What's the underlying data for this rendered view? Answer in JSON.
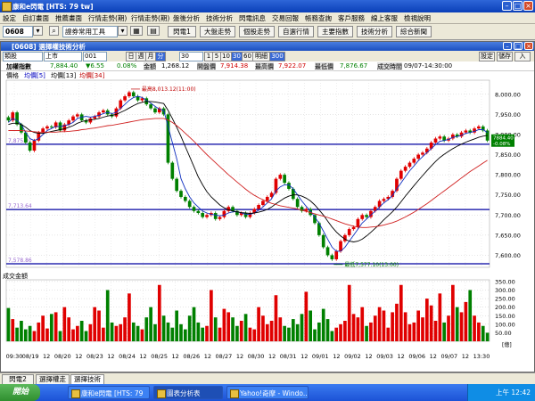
{
  "window": {
    "title": "康和e閃電 [HTS: 79 tw]"
  },
  "menu": [
    "設定",
    "自訂畫面",
    "推薦畫面",
    "行情走勢(期)",
    "行情走勢(期)",
    "盤後分析",
    "技術分析",
    "閃電訊息",
    "交易回報",
    "帳務查詢",
    "客戶服務",
    "線上客服",
    "檢視說明"
  ],
  "toolbar": {
    "code": "0608",
    "tool_select": "證券常用工具",
    "buttons": [
      "閃電1",
      "大盤走勢",
      "個股走勢",
      "自選行情",
      "主要指數",
      "技術分析",
      "綜合新聞"
    ]
  },
  "inner": {
    "title": "[0608] 選擇權技術分析",
    "controls": {
      "kind": "類股",
      "market": "上市",
      "code": "001",
      "periods": [
        "日",
        "週",
        "月",
        "分"
      ],
      "active_period": "分",
      "minute_value": "30",
      "minutes": [
        "1",
        "5",
        "10",
        "30",
        "60"
      ],
      "active_minute": "30",
      "tick": "明細",
      "count": "300",
      "right_buttons": [
        "設定",
        "儲存",
        "入"
      ]
    },
    "info": {
      "name": "加權指數",
      "price": "7,884.40",
      "change": "▼6.55",
      "pct": "0.08%",
      "amt_label": "金額",
      "amt": "1,268.12",
      "open_label": "開盤價",
      "open": "7,914.38",
      "high_label": "最高價",
      "high": "7,922.07",
      "low_label": "最低價",
      "low": "7,876.67",
      "time_label": "成交時間",
      "time": "09/07-14:30:00"
    },
    "legend": {
      "price": "價格",
      "ma5": "均價[5]",
      "ma13": "均價[13]",
      "ma34": "均價[34]"
    },
    "volume_label": "成交金額"
  },
  "chart_data": [
    {
      "type": "candlestick",
      "title": "加權指數",
      "x_labels": [
        "09:30",
        "08/19",
        "12",
        "08/20",
        "12",
        "08/23",
        "12",
        "08/24",
        "12",
        "08/25",
        "12",
        "08/26",
        "12",
        "08/27",
        "12",
        "08/30",
        "12",
        "08/31",
        "12",
        "09/01",
        "12",
        "09/02",
        "12",
        "09/03",
        "12",
        "09/06",
        "12",
        "09/07",
        "12",
        "13:30"
      ],
      "y_ticks": [
        8000,
        7950,
        7900,
        7850,
        7800,
        7750,
        7700,
        7650,
        7600
      ],
      "ylim": [
        7570,
        8035
      ],
      "hlines": [
        {
          "value": 7875.91,
          "label": "7,875.91"
        },
        {
          "value": 7713.64,
          "label": "7,713.64"
        },
        {
          "value": 7578.86,
          "label": "7,578.86"
        }
      ],
      "annotations": [
        {
          "text": "最高8,013.12(11:00)"
        },
        {
          "text": "最低7,577.10(13:00)"
        }
      ],
      "last_price_tag": "7884.40",
      "last_change_tag": "-0.08%",
      "closes": [
        7935,
        7955,
        7925,
        7905,
        7880,
        7860,
        7885,
        7905,
        7915,
        7920,
        7918,
        7930,
        7910,
        7925,
        7935,
        7945,
        7950,
        7935,
        7930,
        7940,
        7945,
        7955,
        7960,
        7950,
        7945,
        7965,
        7985,
        7995,
        8005,
        7995,
        7985,
        7990,
        7975,
        7965,
        7955,
        7965,
        7950,
        7830,
        7790,
        7760,
        7745,
        7735,
        7720,
        7710,
        7705,
        7695,
        7700,
        7705,
        7690,
        7695,
        7710,
        7720,
        7710,
        7700,
        7705,
        7695,
        7705,
        7715,
        7725,
        7735,
        7745,
        7755,
        7790,
        7800,
        7780,
        7765,
        7740,
        7720,
        7710,
        7715,
        7700,
        7680,
        7650,
        7620,
        7600,
        7590,
        7610,
        7635,
        7650,
        7665,
        7670,
        7690,
        7700,
        7695,
        7710,
        7720,
        7735,
        7740,
        7745,
        7760,
        7790,
        7810,
        7820,
        7830,
        7840,
        7850,
        7855,
        7865,
        7880,
        7890,
        7895,
        7885,
        7890,
        7900,
        7895,
        7905,
        7910,
        7905,
        7915,
        7920,
        7910,
        7885
      ],
      "ma5": [
        7930,
        7940,
        7935,
        7925,
        7905,
        7890,
        7885,
        7890,
        7900,
        7910,
        7915,
        7920,
        7920,
        7922,
        7925,
        7930,
        7940,
        7943,
        7945,
        7943,
        7945,
        7948,
        7952,
        7955,
        7952,
        7955,
        7965,
        7975,
        7985,
        7992,
        7995,
        7992,
        7985,
        7978,
        7970,
        7963,
        7960,
        7920,
        7880,
        7840,
        7790,
        7765,
        7745,
        7730,
        7720,
        7710,
        7705,
        7702,
        7700,
        7698,
        7700,
        7705,
        7708,
        7708,
        7705,
        7702,
        7702,
        7705,
        7712,
        7720,
        7730,
        7740,
        7760,
        7770,
        7775,
        7775,
        7765,
        7750,
        7735,
        7722,
        7710,
        7695,
        7680,
        7660,
        7640,
        7620,
        7610,
        7610,
        7620,
        7635,
        7650,
        7665,
        7680,
        7690,
        7700,
        7710,
        7720,
        7730,
        7738,
        7748,
        7765,
        7780,
        7795,
        7810,
        7822,
        7835,
        7845,
        7855,
        7865,
        7875,
        7883,
        7885,
        7888,
        7893,
        7895,
        7898,
        7903,
        7905,
        7908,
        7912,
        7912,
        7905
      ],
      "ma13": [
        7925,
        7928,
        7928,
        7925,
        7918,
        7910,
        7905,
        7903,
        7903,
        7905,
        7908,
        7910,
        7912,
        7914,
        7918,
        7922,
        7928,
        7932,
        7935,
        7936,
        7938,
        7940,
        7943,
        7946,
        7948,
        7950,
        7955,
        7960,
        7966,
        7972,
        7977,
        7980,
        7982,
        7982,
        7981,
        7979,
        7977,
        7960,
        7940,
        7918,
        7895,
        7870,
        7845,
        7820,
        7795,
        7775,
        7758,
        7745,
        7735,
        7725,
        7718,
        7713,
        7710,
        7708,
        7706,
        7705,
        7704,
        7705,
        7707,
        7710,
        7714,
        7720,
        7728,
        7735,
        7742,
        7747,
        7750,
        7750,
        7747,
        7742,
        7735,
        7725,
        7713,
        7700,
        7685,
        7670,
        7658,
        7648,
        7640,
        7635,
        7633,
        7635,
        7640,
        7648,
        7657,
        7667,
        7677,
        7688,
        7698,
        7708,
        7720,
        7733,
        7747,
        7760,
        7773,
        7786,
        7798,
        7810,
        7822,
        7833,
        7843,
        7851,
        7858,
        7865,
        7871,
        7876,
        7881,
        7885,
        7889,
        7893,
        7896,
        7898
      ],
      "ma34": [
        7910,
        7910,
        7910,
        7910,
        7909,
        7908,
        7907,
        7906,
        7906,
        7906,
        7906,
        7906,
        7907,
        7907,
        7908,
        7909,
        7910,
        7912,
        7913,
        7915,
        7916,
        7918,
        7920,
        7922,
        7923,
        7925,
        7927,
        7929,
        7931,
        7933,
        7935,
        7937,
        7938,
        7939,
        7940,
        7940,
        7940,
        7936,
        7930,
        7922,
        7913,
        7903,
        7893,
        7883,
        7872,
        7861,
        7850,
        7840,
        7830,
        7820,
        7810,
        7800,
        7791,
        7782,
        7773,
        7764,
        7756,
        7749,
        7743,
        7738,
        7733,
        7729,
        7726,
        7723,
        7721,
        7719,
        7717,
        7715,
        7712,
        7709,
        7706,
        7703,
        7700,
        7697,
        7694,
        7690,
        7686,
        7682,
        7678,
        7675,
        7672,
        7670,
        7669,
        7669,
        7670,
        7671,
        7673,
        7675,
        7678,
        7681,
        7685,
        7690,
        7695,
        7701,
        7707,
        7714,
        7721,
        7728,
        7736,
        7744,
        7752,
        7760,
        7768,
        7776,
        7784,
        7792,
        7800,
        7808,
        7815,
        7822,
        7829,
        7836
      ]
    },
    {
      "type": "bar",
      "title": "成交金額",
      "y_ticks": [
        350,
        300,
        250,
        200,
        150,
        100,
        50
      ],
      "ylim": [
        0,
        360
      ],
      "unit": "[億]",
      "values": [
        195,
        130,
        80,
        120,
        70,
        90,
        60,
        110,
        150,
        75,
        160,
        170,
        60,
        200,
        140,
        70,
        90,
        120,
        60,
        100,
        200,
        180,
        80,
        300,
        110,
        90,
        100,
        140,
        280,
        110,
        90,
        70,
        140,
        200,
        100,
        330,
        150,
        110,
        80,
        180,
        100,
        70,
        150,
        200,
        110,
        80,
        90,
        300,
        140,
        80,
        190,
        170,
        140,
        90,
        120,
        160,
        80,
        70,
        200,
        150,
        100,
        120,
        270,
        140,
        90,
        80,
        130,
        100,
        160,
        290,
        180,
        70,
        110,
        190,
        130,
        60,
        80,
        100,
        120,
        330,
        160,
        140,
        200,
        90,
        110,
        150,
        200,
        180,
        80,
        170,
        220,
        330,
        170,
        100,
        110,
        180,
        140,
        250,
        210,
        120,
        280,
        110,
        150,
        330,
        200,
        170,
        230,
        300,
        150,
        110,
        90,
        50
      ]
    }
  ],
  "bottom_tabs": [
    "閃電2",
    "選擇權走",
    "選擇技術"
  ],
  "taskbar": {
    "start": "開始",
    "tasks": [
      "康和e閃電 [HTS: 79",
      "圖表分析表",
      "Yahoo!奇摩 - Windo..."
    ],
    "clock": "上午 12:42"
  }
}
